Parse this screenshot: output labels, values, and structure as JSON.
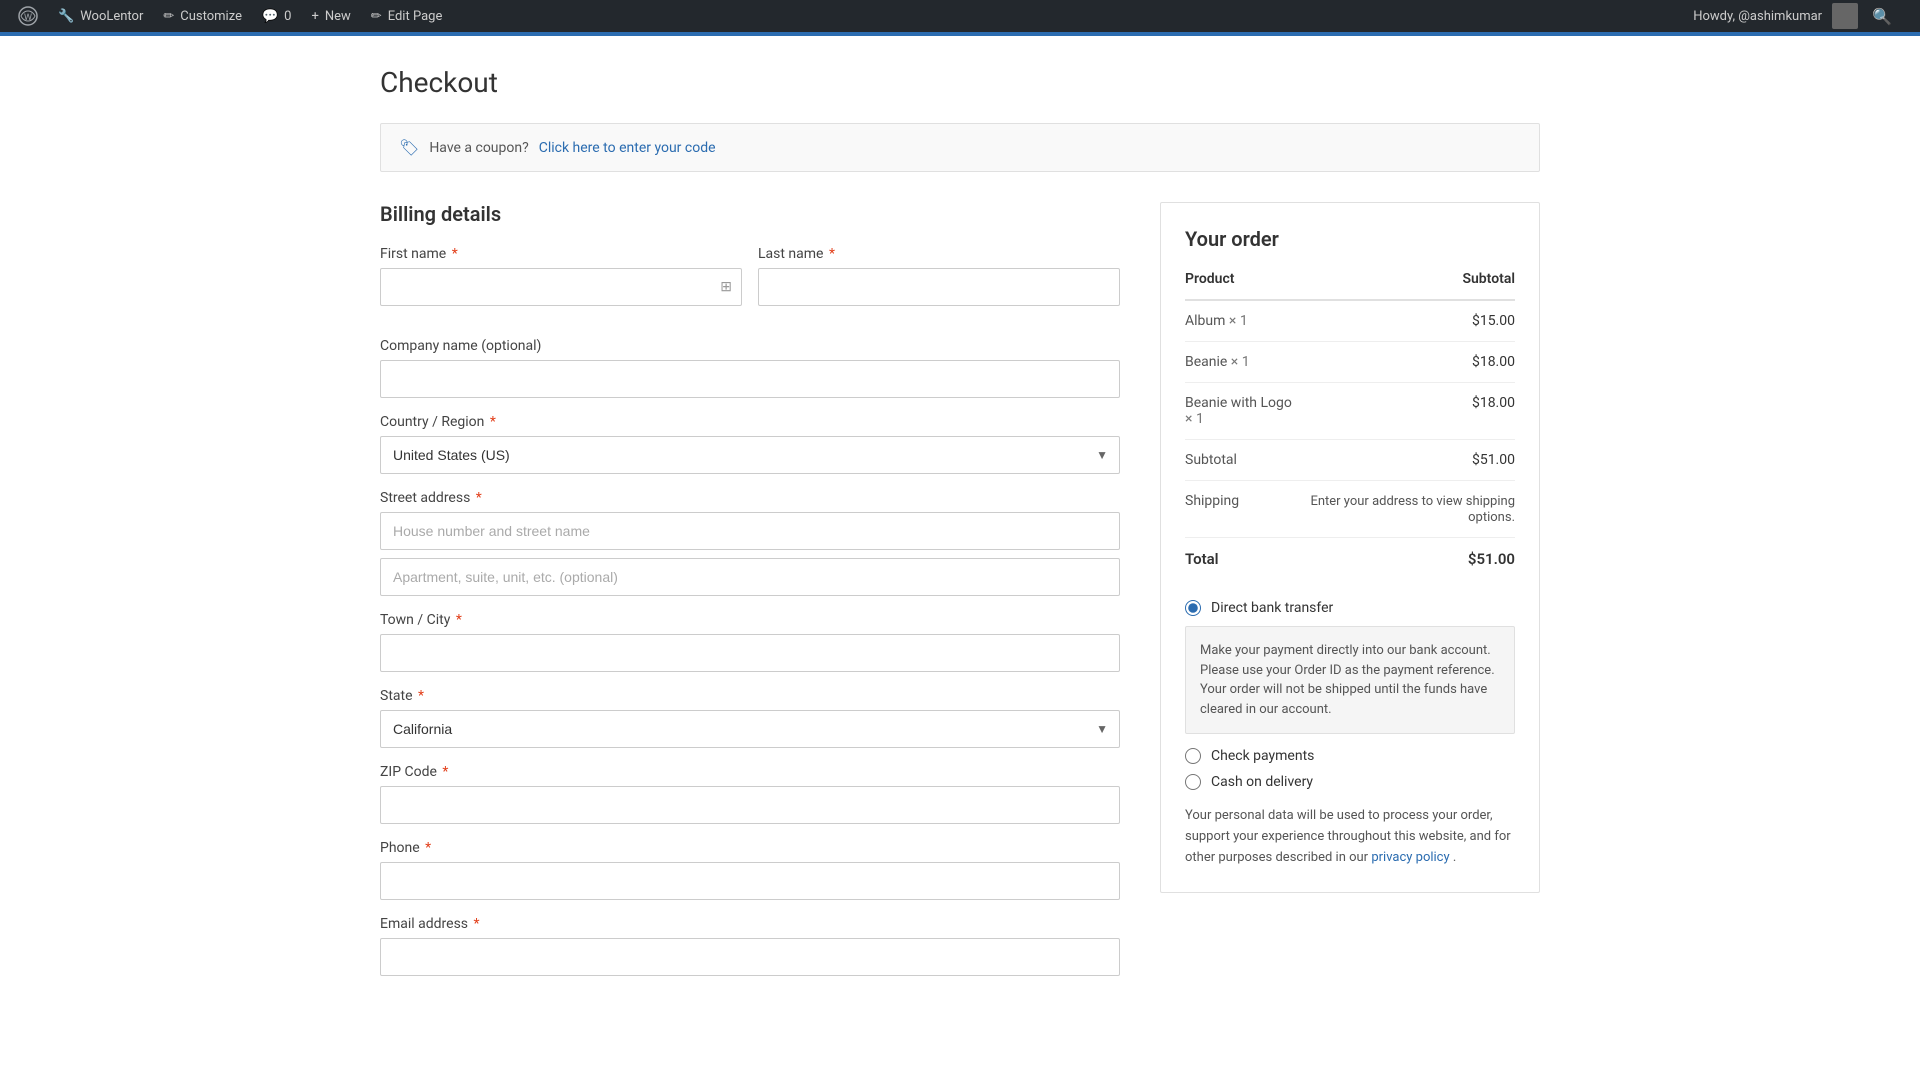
{
  "adminbar": {
    "wp_icon": "⚙",
    "items": [
      {
        "id": "wp-logo",
        "label": "",
        "icon": "wordpress"
      },
      {
        "id": "woolentor",
        "label": "WooLentor",
        "icon": "wl"
      },
      {
        "id": "customize",
        "label": "Customize",
        "icon": "✏"
      },
      {
        "id": "comments",
        "label": "0",
        "icon": "💬"
      },
      {
        "id": "new",
        "label": "New",
        "icon": "+"
      },
      {
        "id": "edit-page",
        "label": "Edit Page",
        "icon": "✏"
      }
    ],
    "right_text": "Howdy, @ashimkumar",
    "search_icon": "🔍"
  },
  "page": {
    "title": "Checkout"
  },
  "coupon": {
    "text": "Have a coupon?",
    "link_text": "Click here to enter your code"
  },
  "billing": {
    "section_title": "Billing details",
    "fields": {
      "first_name": {
        "label": "First name",
        "placeholder": "",
        "required": true
      },
      "last_name": {
        "label": "Last name",
        "placeholder": "",
        "required": true
      },
      "company": {
        "label": "Company name (optional)",
        "placeholder": ""
      },
      "country": {
        "label": "Country / Region",
        "required": true,
        "value": "United States (US)"
      },
      "street_address": {
        "label": "Street address",
        "required": true,
        "placeholder1": "House number and street name",
        "placeholder2": "Apartment, suite, unit, etc. (optional)"
      },
      "town_city": {
        "label": "Town / City",
        "required": true,
        "placeholder": ""
      },
      "state": {
        "label": "State",
        "required": true,
        "value": "California"
      },
      "zip_code": {
        "label": "ZIP Code",
        "required": true,
        "placeholder": ""
      },
      "phone": {
        "label": "Phone",
        "required": true,
        "placeholder": ""
      },
      "email": {
        "label": "Email address",
        "required": true,
        "placeholder": ""
      }
    }
  },
  "order": {
    "title": "Your order",
    "col_product": "Product",
    "col_subtotal": "Subtotal",
    "items": [
      {
        "name": "Album",
        "qty": "× 1",
        "price": "$15.00"
      },
      {
        "name": "Beanie",
        "qty": "× 1",
        "price": "$18.00"
      },
      {
        "name": "Beanie with Logo",
        "qty": "× 1",
        "price": "$18.00"
      }
    ],
    "subtotal_label": "Subtotal",
    "subtotal_value": "$51.00",
    "shipping_label": "Shipping",
    "shipping_value": "Enter your address to view shipping options.",
    "total_label": "Total",
    "total_value": "$51.00"
  },
  "payment": {
    "options": [
      {
        "id": "direct-bank",
        "label": "Direct bank transfer",
        "selected": true,
        "info": "Make your payment directly into our bank account. Please use your Order ID as the payment reference. Your order will not be shipped until the funds have cleared in our account."
      },
      {
        "id": "check-payments",
        "label": "Check payments",
        "selected": false,
        "info": ""
      },
      {
        "id": "cash-on-delivery",
        "label": "Cash on delivery",
        "selected": false,
        "info": ""
      }
    ]
  },
  "privacy": {
    "text_before": "Your personal data will be used to process your order, support your experience throughout this website, and for other purposes described in our",
    "link_text": "privacy policy",
    "text_after": "."
  }
}
